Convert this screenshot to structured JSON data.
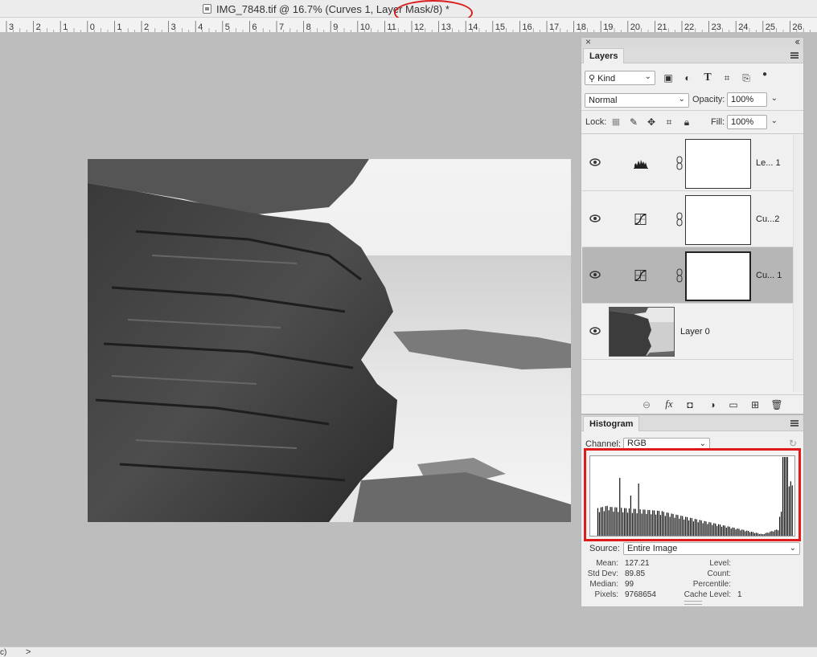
{
  "window": {
    "title": "IMG_7848.tif @ 16.7% (Curves 1, Layer Mask/8) *"
  },
  "ruler": {
    "ticks": [
      "3",
      "2",
      "1",
      "0",
      "1",
      "2",
      "3",
      "4",
      "5",
      "6",
      "7",
      "8",
      "9",
      "10",
      "11",
      "12",
      "13",
      "14",
      "15",
      "16",
      "17",
      "18",
      "19",
      "20",
      "21",
      "22",
      "23",
      "24",
      "25",
      "26"
    ]
  },
  "layers_panel": {
    "tab_label": "Layers",
    "filter_select": "Kind",
    "blend_mode": "Normal",
    "opacity_label": "Opacity:",
    "opacity_value": "100%",
    "lock_label": "Lock:",
    "fill_label": "Fill:",
    "fill_value": "100%",
    "layers": [
      {
        "name": "Le... 1",
        "type": "levels-icon",
        "selected": false,
        "visible": true
      },
      {
        "name": "Cu...2",
        "type": "curves-icon",
        "selected": false,
        "visible": true
      },
      {
        "name": "Cu... 1",
        "type": "curves-icon",
        "selected": true,
        "visible": true
      },
      {
        "name": "Layer 0",
        "type": "image",
        "selected": false,
        "visible": true
      }
    ]
  },
  "histogram_panel": {
    "tab_label": "Histogram",
    "channel_label": "Channel:",
    "channel_value": "RGB",
    "source_label": "Source:",
    "source_value": "Entire Image",
    "stats": {
      "mean_label": "Mean:",
      "mean_value": "127.21",
      "stddev_label": "Std Dev:",
      "stddev_value": "89.85",
      "median_label": "Median:",
      "median_value": "99",
      "pixels_label": "Pixels:",
      "pixels_value": "9768654",
      "level_label": "Level:",
      "level_value": "",
      "count_label": "Count:",
      "count_value": "",
      "percentile_label": "Percentile:",
      "percentile_value": "",
      "cache_label": "Cache Level:",
      "cache_value": "1"
    }
  },
  "statusbar": {
    "text": "c)",
    "arrow": ">"
  },
  "colors": {
    "annotation_red": "#e01a1a",
    "canvas_gray": "#bdbdbd",
    "selected_row": "#b6b6b6"
  }
}
